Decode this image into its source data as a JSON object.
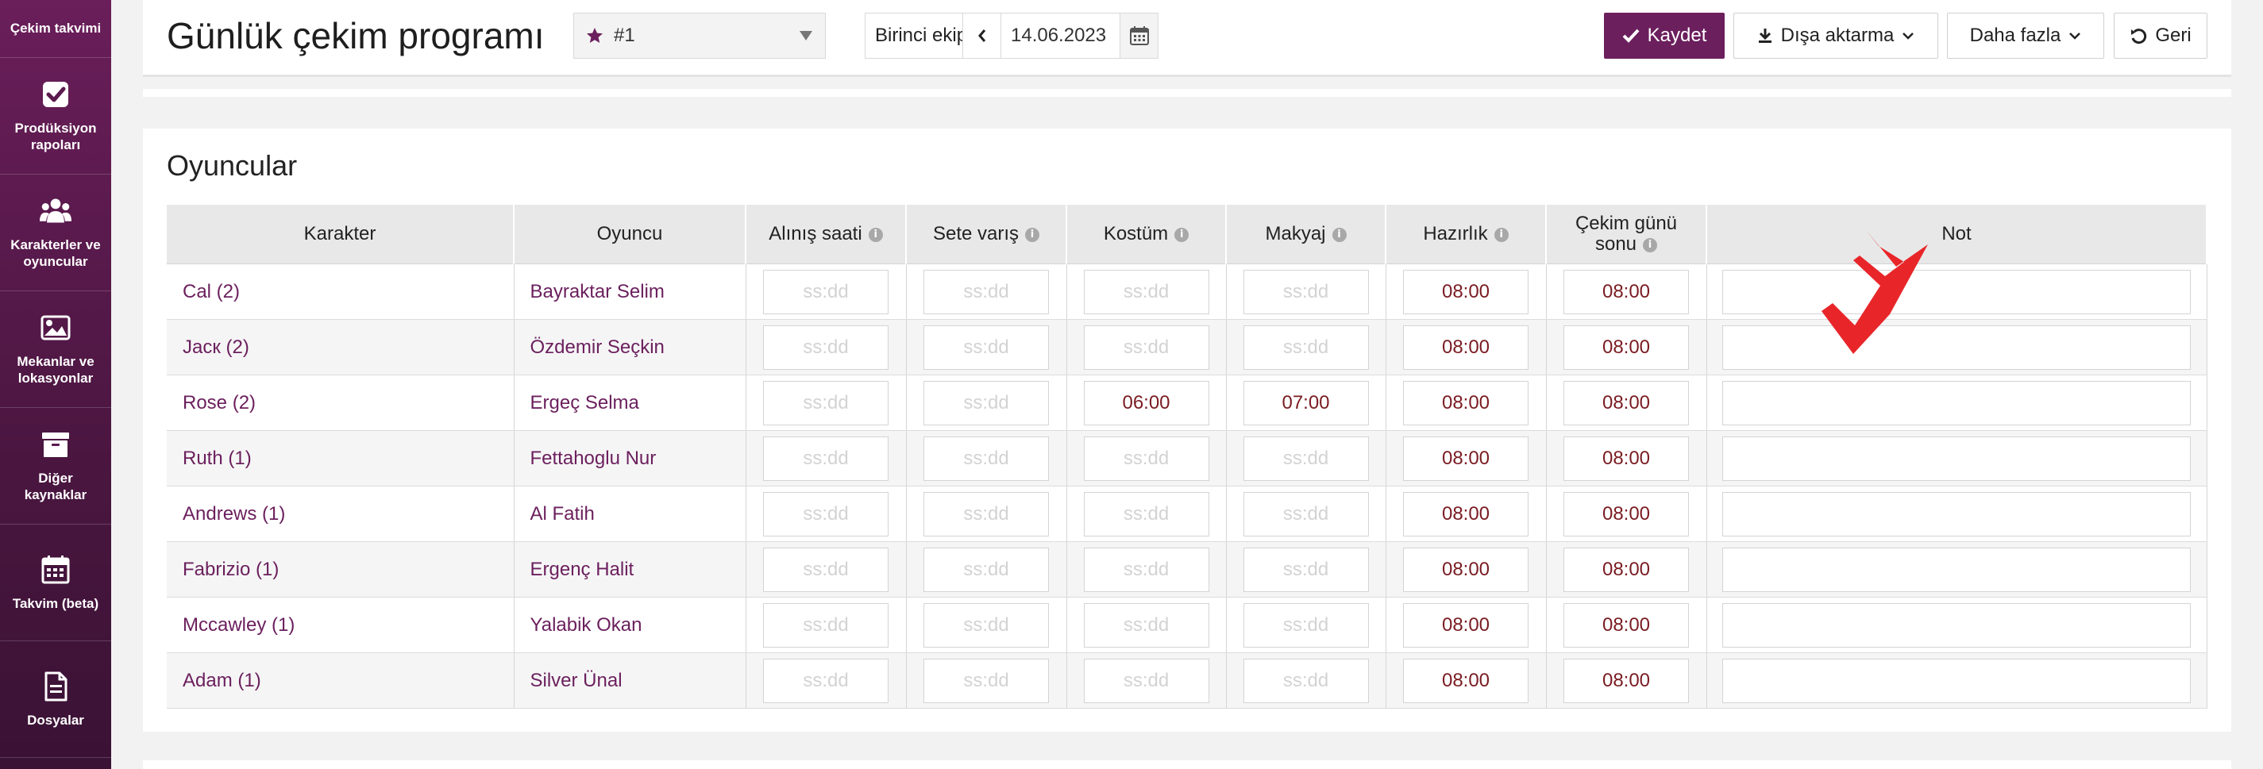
{
  "sidebar": {
    "top_item": "Çekim takvimi",
    "items": [
      {
        "label": "Prodüksiyon rapoları",
        "icon": "checkbox-icon"
      },
      {
        "label": "Karakterler ve oyuncular",
        "icon": "users-icon"
      },
      {
        "label": "Mekanlar ve lokasyonlar",
        "icon": "image-icon"
      },
      {
        "label": "Diğer kaynaklar",
        "icon": "archive-icon"
      },
      {
        "label": "Takvim (beta)",
        "icon": "calendar-icon"
      },
      {
        "label": "Dosyalar",
        "icon": "file-icon"
      }
    ]
  },
  "header": {
    "title": "Günlük çekim programı",
    "schedule_select": "#1",
    "team": "Birinci ekip",
    "date": "14.06.2023",
    "save_label": "Kaydet",
    "export_label": "Dışa aktarma",
    "more_label": "Daha fazla",
    "back_label": "Geri"
  },
  "actors": {
    "section_title": "Oyuncular",
    "columns": {
      "character": "Karakter",
      "actor": "Oyuncu",
      "pickup": "Alınış saati",
      "arrival": "Sete varış",
      "costume": "Kostüm",
      "makeup": "Makyaj",
      "ready": "Hazırlık",
      "wrap_line1": "Çekim günü",
      "wrap_line2": "sonu",
      "note": "Not"
    },
    "time_placeholder": "ss:dd",
    "rows": [
      {
        "character": "Cal (2)",
        "actor": "Bayraktar Selim",
        "pickup": "",
        "arrival": "",
        "costume": "",
        "makeup": "",
        "ready": "08:00",
        "wrap": "08:00",
        "note": ""
      },
      {
        "character": "Jacк (2)",
        "actor": "Özdemir Seçkin",
        "pickup": "",
        "arrival": "",
        "costume": "",
        "makeup": "",
        "ready": "08:00",
        "wrap": "08:00",
        "note": ""
      },
      {
        "character": "Rose (2)",
        "actor": "Ergeç Selma",
        "pickup": "",
        "arrival": "",
        "costume": "06:00",
        "makeup": "07:00",
        "ready": "08:00",
        "wrap": "08:00",
        "note": ""
      },
      {
        "character": "Ruth (1)",
        "actor": "Fettahoglu Nur",
        "pickup": "",
        "arrival": "",
        "costume": "",
        "makeup": "",
        "ready": "08:00",
        "wrap": "08:00",
        "note": ""
      },
      {
        "character": "Andrews (1)",
        "actor": "Al Fatih",
        "pickup": "",
        "arrival": "",
        "costume": "",
        "makeup": "",
        "ready": "08:00",
        "wrap": "08:00",
        "note": ""
      },
      {
        "character": "Fabrizio (1)",
        "actor": "Ergenç Halit",
        "pickup": "",
        "arrival": "",
        "costume": "",
        "makeup": "",
        "ready": "08:00",
        "wrap": "08:00",
        "note": ""
      },
      {
        "character": "Mccawley (1)",
        "actor": "Yalabik Okan",
        "pickup": "",
        "arrival": "",
        "costume": "",
        "makeup": "",
        "ready": "08:00",
        "wrap": "08:00",
        "note": ""
      },
      {
        "character": "Adam (1)",
        "actor": "Silver Ünal",
        "pickup": "",
        "arrival": "",
        "costume": "",
        "makeup": "",
        "ready": "08:00",
        "wrap": "08:00",
        "note": ""
      }
    ]
  },
  "colors": {
    "brand": "#6b1f5d",
    "time_text": "#7a1c22",
    "arrow": "#e8262a"
  }
}
